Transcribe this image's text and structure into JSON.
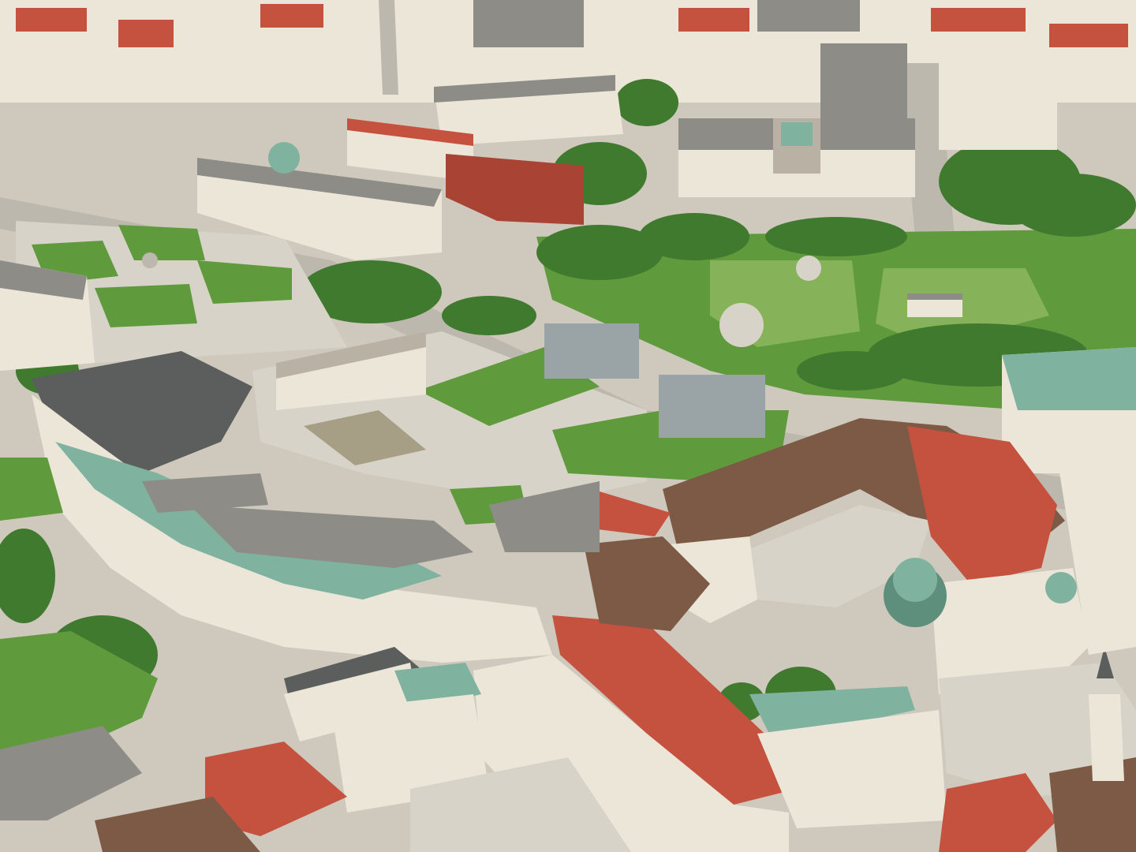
{
  "view": {
    "mode": "3d-aerial-photograph",
    "subject": "city-centre-palace-complex",
    "visible_text": []
  },
  "palette": {
    "city_fabric": "#cfc8bd",
    "roof_red": "#c5523e",
    "roof_red_dark": "#a94434",
    "roof_brown": "#7d5a46",
    "copper_green": "#7fb3a0",
    "copper_green_dark": "#5e8f7c",
    "facade_cream": "#ece6d8",
    "facade_shadow": "#b9b2a4",
    "grey_roof": "#8d8c86",
    "dark_roof": "#5b5e5c",
    "lawn": "#5f9a3c",
    "lawn_light": "#86b25a",
    "tree": "#3f7a2f",
    "tree_dark": "#2f5f24",
    "plaza": "#d8d3c8",
    "road": "#bdb8ae",
    "dirt": "#a79e86",
    "modern_glass": "#9aa3a6"
  },
  "legend": []
}
